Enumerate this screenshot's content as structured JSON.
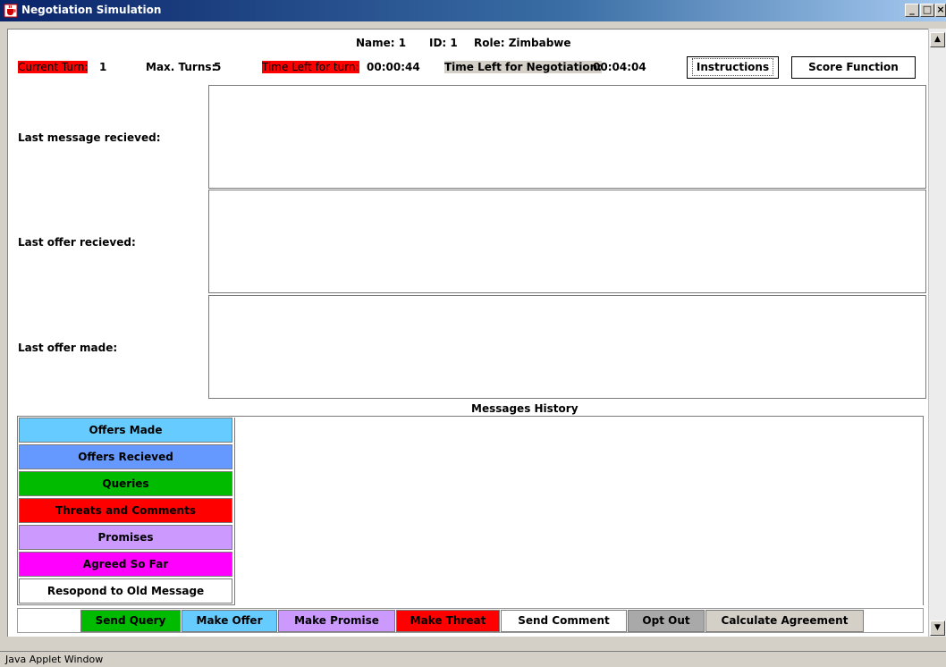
{
  "window": {
    "title": "Negotiation Simulation",
    "status_bar": "Java Applet Window"
  },
  "header": {
    "name_label": "Name: 1",
    "id_label": "ID: 1",
    "role_label": "Role: Zimbabwe",
    "current_turn_label": "Current Turn:",
    "current_turn_value": "1",
    "max_turns_label": "Max. Turns:",
    "max_turns_value": "5",
    "time_left_turn_label": "Time Left for turn:",
    "time_left_turn_value": "00:00:44",
    "time_left_negotiation_label": "Time Left for Negotiation:",
    "time_left_negotiation_value": "00:04:04",
    "instructions_button": "Instructions",
    "score_function_button": "Score Function"
  },
  "panels": {
    "last_message_label": "Last message recieved:",
    "last_offer_received_label": "Last offer recieved:",
    "last_offer_made_label": "Last offer made:"
  },
  "history": {
    "title": "Messages History",
    "filters": [
      {
        "label": "Offers Made",
        "color": "#66ccff"
      },
      {
        "label": "Offers Recieved",
        "color": "#6699ff"
      },
      {
        "label": "Queries",
        "color": "#00bb00"
      },
      {
        "label": "Threats and Comments",
        "color": "#ff0000"
      },
      {
        "label": "Promises",
        "color": "#cc99ff"
      },
      {
        "label": "Agreed So Far",
        "color": "#ff00ff"
      },
      {
        "label": "Resopond to Old Message",
        "color": "#ffffff"
      }
    ]
  },
  "actions": {
    "send_query": "Send Query",
    "make_offer": "Make Offer",
    "make_promise": "Make Promise",
    "make_threat": "Make Threat",
    "send_comment": "Send Comment",
    "opt_out": "Opt Out",
    "calculate_agreement": "Calculate Agreement"
  },
  "colors": {
    "title_bar": "#0a246a",
    "highlight_red": "#ff0000",
    "highlight_gray": "#d4d0c8",
    "query_green": "#00bb00",
    "offer_blue": "#66ccff",
    "promise_purple": "#cc99ff"
  },
  "icons": {
    "app": "java-cup-icon",
    "minimize": "minimize-icon",
    "maximize": "maximize-icon",
    "close": "close-icon"
  }
}
